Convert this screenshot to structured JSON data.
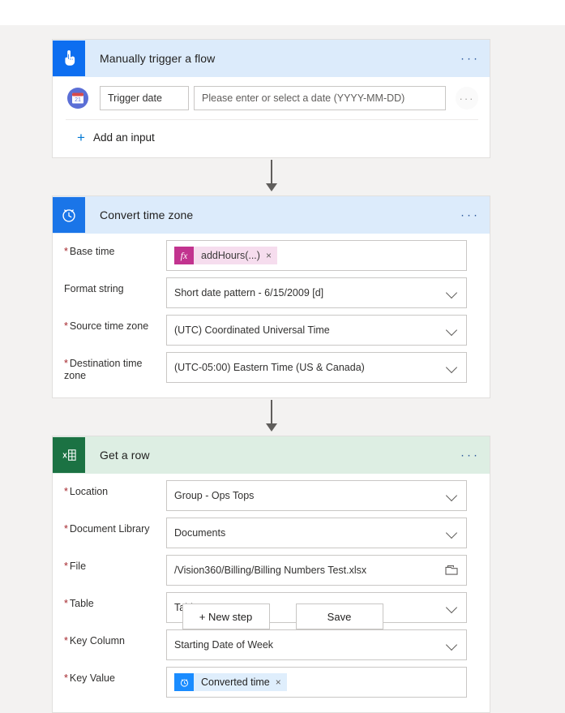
{
  "theme": {
    "page_background": "#f3f2f1",
    "trigger_header_background": "#dcebfb",
    "action_header_background": "#dcebfb",
    "excel_header_background": "#ddeee3",
    "trigger_icon_background": "#0d6ef0",
    "clock_icon_background": "#1a75e8",
    "excel_icon_background": "#1b7243",
    "required_star_color": "#a4262c",
    "accent_link_color": "#0078d4",
    "fx_token_background": "#f6ddee",
    "fx_icon_background": "#c2338f",
    "dynamic_token_background": "#dfeefc",
    "dynamic_token_icon_background": "#1a8cff"
  },
  "cards": {
    "trigger": {
      "icon": "touch-trigger-icon",
      "title": "Manually trigger a flow",
      "more_label": "···",
      "input_row": {
        "icon": "calendar-icon",
        "field_name": "Trigger date",
        "placeholder": "Please enter or select a date (YYYY-MM-DD)",
        "value": "",
        "more_label": "···"
      },
      "add_input": {
        "plus": "+",
        "label": "Add an input"
      }
    },
    "convert_time_zone": {
      "icon": "alarm-clock-icon",
      "title": "Convert time zone",
      "more_label": "···",
      "fields": [
        {
          "label": "Base time",
          "required": true,
          "type": "token",
          "token_kind": "fx",
          "token_icon": "fx-icon",
          "token_text": "addHours(...)",
          "token_remove": "×"
        },
        {
          "label": "Format string",
          "required": false,
          "type": "dropdown",
          "value": "Short date pattern - 6/15/2009 [d]"
        },
        {
          "label": "Source time zone",
          "required": true,
          "type": "dropdown",
          "value": "(UTC) Coordinated Universal Time"
        },
        {
          "label": "Destination time zone",
          "required": true,
          "type": "dropdown",
          "value": "(UTC-05:00) Eastern Time (US & Canada)"
        }
      ]
    },
    "get_a_row": {
      "icon": "excel-icon",
      "title": "Get a row",
      "more_label": "···",
      "fields": [
        {
          "label": "Location",
          "required": true,
          "type": "dropdown",
          "value": "Group - Ops Tops"
        },
        {
          "label": "Document Library",
          "required": true,
          "type": "dropdown",
          "value": "Documents"
        },
        {
          "label": "File",
          "required": true,
          "type": "file-picker",
          "value": "/Vision360/Billing/Billing Numbers Test.xlsx",
          "picker_icon": "folder-icon"
        },
        {
          "label": "Table",
          "required": true,
          "type": "dropdown",
          "value": "Table1"
        },
        {
          "label": "Key Column",
          "required": true,
          "type": "dropdown",
          "value": "Starting Date of Week"
        },
        {
          "label": "Key Value",
          "required": true,
          "type": "token",
          "token_kind": "dynamic",
          "token_icon": "alarm-clock-icon",
          "token_text": "Converted time",
          "token_remove": "×"
        }
      ]
    }
  },
  "footer": {
    "new_step_label": "+ New step",
    "save_label": "Save"
  }
}
